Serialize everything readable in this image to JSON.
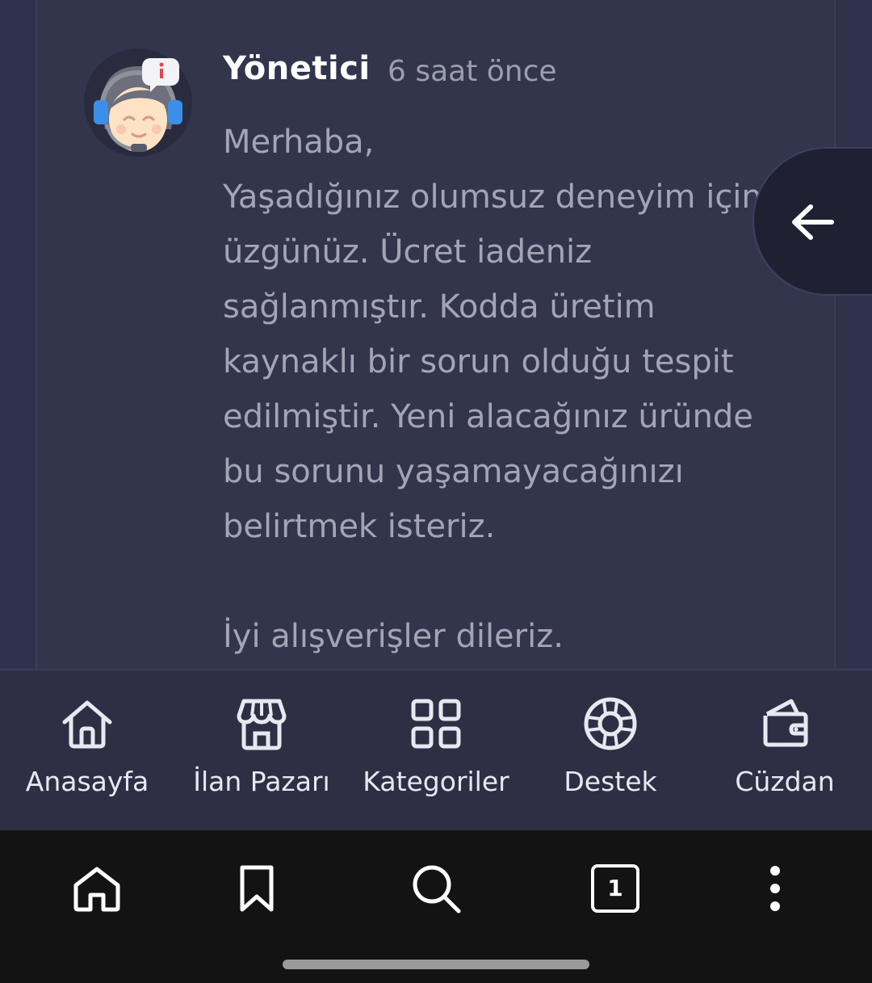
{
  "comment": {
    "author": "Yönetici",
    "time": "6 saat önce",
    "paragraphs": [
      "Merhaba,",
      "Yaşadığınız olumsuz deneyim için üzgünüz. Ücret iadeniz sağlanmıştır. Kodda üretim kaynaklı bir sorun olduğu tespit edilmiştir. Yeni alacağınız üründe bu sorunu yaşamayacağınızı belirtmek isteriz.",
      "İyi alışverişler dileriz."
    ]
  },
  "bottom_nav": {
    "items": [
      {
        "label": "Anasayfa",
        "icon": "home-icon"
      },
      {
        "label": "İlan Pazarı",
        "icon": "store-icon"
      },
      {
        "label": "Kategoriler",
        "icon": "grid-icon"
      },
      {
        "label": "Destek",
        "icon": "lifebuoy-icon"
      },
      {
        "label": "Cüzdan",
        "icon": "wallet-icon"
      }
    ]
  },
  "browser": {
    "tab_count": "1"
  },
  "colors": {
    "background": "#2e2f44",
    "card": "#33354d",
    "text_primary": "#ffffff",
    "text_secondary": "#a3a5b6",
    "browser_bar": "#131313"
  }
}
